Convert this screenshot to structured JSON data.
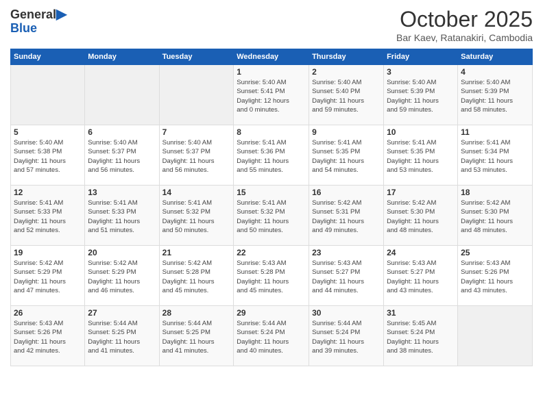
{
  "logo": {
    "general": "General",
    "blue": "Blue"
  },
  "header": {
    "month": "October 2025",
    "location": "Bar Kaev, Ratanakiri, Cambodia"
  },
  "weekdays": [
    "Sunday",
    "Monday",
    "Tuesday",
    "Wednesday",
    "Thursday",
    "Friday",
    "Saturday"
  ],
  "weeks": [
    [
      {
        "day": "",
        "info": ""
      },
      {
        "day": "",
        "info": ""
      },
      {
        "day": "",
        "info": ""
      },
      {
        "day": "1",
        "info": "Sunrise: 5:40 AM\nSunset: 5:41 PM\nDaylight: 12 hours\nand 0 minutes."
      },
      {
        "day": "2",
        "info": "Sunrise: 5:40 AM\nSunset: 5:40 PM\nDaylight: 11 hours\nand 59 minutes."
      },
      {
        "day": "3",
        "info": "Sunrise: 5:40 AM\nSunset: 5:39 PM\nDaylight: 11 hours\nand 59 minutes."
      },
      {
        "day": "4",
        "info": "Sunrise: 5:40 AM\nSunset: 5:39 PM\nDaylight: 11 hours\nand 58 minutes."
      }
    ],
    [
      {
        "day": "5",
        "info": "Sunrise: 5:40 AM\nSunset: 5:38 PM\nDaylight: 11 hours\nand 57 minutes."
      },
      {
        "day": "6",
        "info": "Sunrise: 5:40 AM\nSunset: 5:37 PM\nDaylight: 11 hours\nand 56 minutes."
      },
      {
        "day": "7",
        "info": "Sunrise: 5:40 AM\nSunset: 5:37 PM\nDaylight: 11 hours\nand 56 minutes."
      },
      {
        "day": "8",
        "info": "Sunrise: 5:41 AM\nSunset: 5:36 PM\nDaylight: 11 hours\nand 55 minutes."
      },
      {
        "day": "9",
        "info": "Sunrise: 5:41 AM\nSunset: 5:35 PM\nDaylight: 11 hours\nand 54 minutes."
      },
      {
        "day": "10",
        "info": "Sunrise: 5:41 AM\nSunset: 5:35 PM\nDaylight: 11 hours\nand 53 minutes."
      },
      {
        "day": "11",
        "info": "Sunrise: 5:41 AM\nSunset: 5:34 PM\nDaylight: 11 hours\nand 53 minutes."
      }
    ],
    [
      {
        "day": "12",
        "info": "Sunrise: 5:41 AM\nSunset: 5:33 PM\nDaylight: 11 hours\nand 52 minutes."
      },
      {
        "day": "13",
        "info": "Sunrise: 5:41 AM\nSunset: 5:33 PM\nDaylight: 11 hours\nand 51 minutes."
      },
      {
        "day": "14",
        "info": "Sunrise: 5:41 AM\nSunset: 5:32 PM\nDaylight: 11 hours\nand 50 minutes."
      },
      {
        "day": "15",
        "info": "Sunrise: 5:41 AM\nSunset: 5:32 PM\nDaylight: 11 hours\nand 50 minutes."
      },
      {
        "day": "16",
        "info": "Sunrise: 5:42 AM\nSunset: 5:31 PM\nDaylight: 11 hours\nand 49 minutes."
      },
      {
        "day": "17",
        "info": "Sunrise: 5:42 AM\nSunset: 5:30 PM\nDaylight: 11 hours\nand 48 minutes."
      },
      {
        "day": "18",
        "info": "Sunrise: 5:42 AM\nSunset: 5:30 PM\nDaylight: 11 hours\nand 48 minutes."
      }
    ],
    [
      {
        "day": "19",
        "info": "Sunrise: 5:42 AM\nSunset: 5:29 PM\nDaylight: 11 hours\nand 47 minutes."
      },
      {
        "day": "20",
        "info": "Sunrise: 5:42 AM\nSunset: 5:29 PM\nDaylight: 11 hours\nand 46 minutes."
      },
      {
        "day": "21",
        "info": "Sunrise: 5:42 AM\nSunset: 5:28 PM\nDaylight: 11 hours\nand 45 minutes."
      },
      {
        "day": "22",
        "info": "Sunrise: 5:43 AM\nSunset: 5:28 PM\nDaylight: 11 hours\nand 45 minutes."
      },
      {
        "day": "23",
        "info": "Sunrise: 5:43 AM\nSunset: 5:27 PM\nDaylight: 11 hours\nand 44 minutes."
      },
      {
        "day": "24",
        "info": "Sunrise: 5:43 AM\nSunset: 5:27 PM\nDaylight: 11 hours\nand 43 minutes."
      },
      {
        "day": "25",
        "info": "Sunrise: 5:43 AM\nSunset: 5:26 PM\nDaylight: 11 hours\nand 43 minutes."
      }
    ],
    [
      {
        "day": "26",
        "info": "Sunrise: 5:43 AM\nSunset: 5:26 PM\nDaylight: 11 hours\nand 42 minutes."
      },
      {
        "day": "27",
        "info": "Sunrise: 5:44 AM\nSunset: 5:25 PM\nDaylight: 11 hours\nand 41 minutes."
      },
      {
        "day": "28",
        "info": "Sunrise: 5:44 AM\nSunset: 5:25 PM\nDaylight: 11 hours\nand 41 minutes."
      },
      {
        "day": "29",
        "info": "Sunrise: 5:44 AM\nSunset: 5:24 PM\nDaylight: 11 hours\nand 40 minutes."
      },
      {
        "day": "30",
        "info": "Sunrise: 5:44 AM\nSunset: 5:24 PM\nDaylight: 11 hours\nand 39 minutes."
      },
      {
        "day": "31",
        "info": "Sunrise: 5:45 AM\nSunset: 5:24 PM\nDaylight: 11 hours\nand 38 minutes."
      },
      {
        "day": "",
        "info": ""
      }
    ]
  ]
}
